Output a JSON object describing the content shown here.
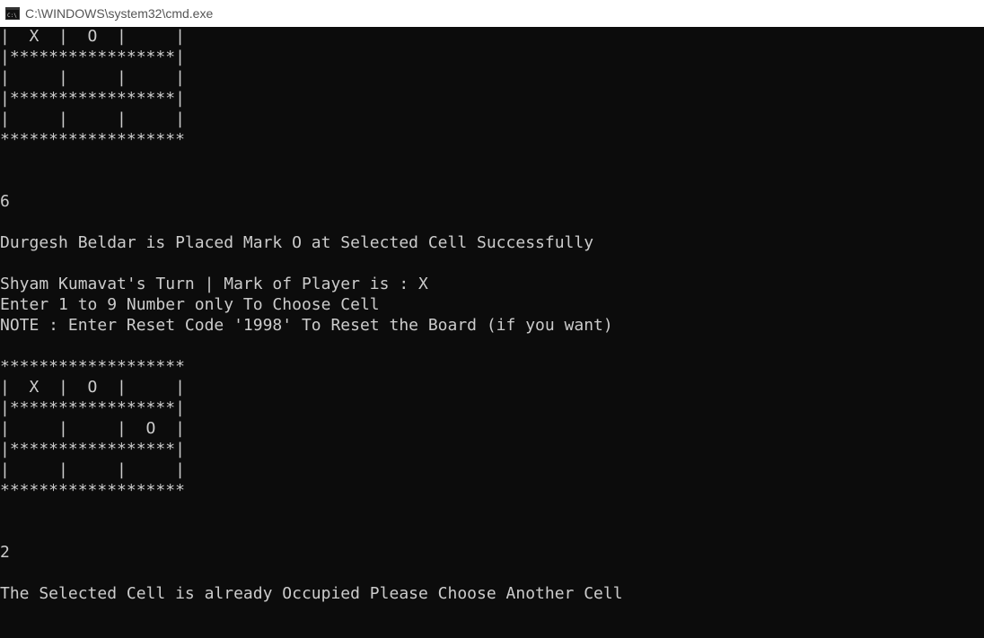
{
  "window": {
    "title": "C:\\WINDOWS\\system32\\cmd.exe",
    "icon": "cmd-window-icon",
    "colors": {
      "background": "#0c0c0c",
      "text": "#cccccc",
      "titlebar": "#ffffff"
    }
  },
  "console": {
    "lines": [
      "|  X  |  O  |     |",
      "|*****************|",
      "|     |     |     |",
      "|*****************|",
      "|     |     |     |",
      "*******************",
      "",
      "",
      "6",
      "",
      "Durgesh Beldar is Placed Mark O at Selected Cell Successfully",
      "",
      "Shyam Kumavat's Turn | Mark of Player is : X",
      "Enter 1 to 9 Number only To Choose Cell",
      "NOTE : Enter Reset Code '1998' To Reset the Board (if you want)",
      "",
      "*******************",
      "|  X  |  O  |     |",
      "|*****************|",
      "|     |     |  O  |",
      "|*****************|",
      "|     |     |     |",
      "*******************",
      "",
      "",
      "2",
      "",
      "The Selected Cell is already Occupied Please Choose Another Cell"
    ]
  }
}
